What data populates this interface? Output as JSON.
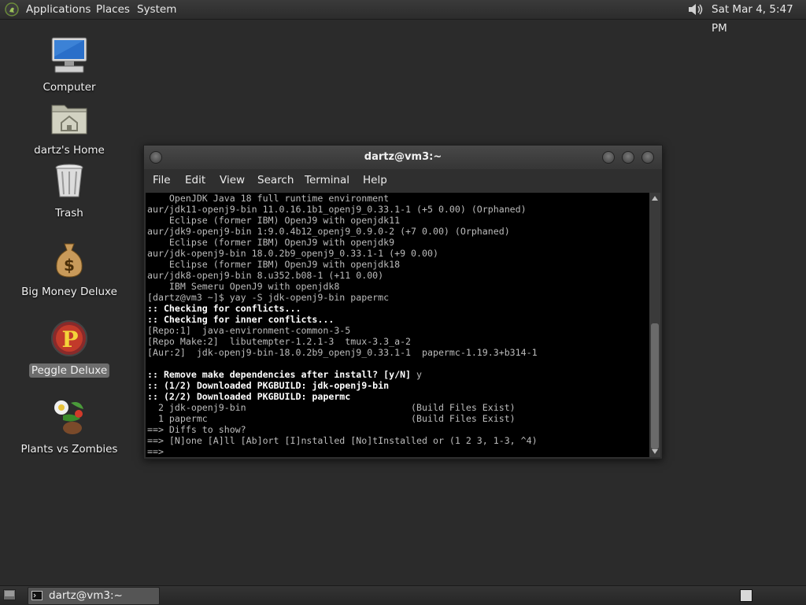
{
  "top_panel": {
    "menus": [
      "Applications",
      "Places",
      "System"
    ],
    "clock": "Sat Mar  4,  5:47 PM",
    "icons": {
      "foot": "gnome-foot-icon",
      "volume": "speaker-icon"
    }
  },
  "desktop_icons": [
    {
      "label": "Computer",
      "icon": "computer-icon"
    },
    {
      "label": "dartz's Home",
      "icon": "home-folder-icon"
    },
    {
      "label": "Trash",
      "icon": "trash-icon"
    },
    {
      "label": "Big Money Deluxe",
      "icon": "money-bag-icon"
    },
    {
      "label": "Peggle Deluxe",
      "icon": "peggle-icon",
      "selected": true
    },
    {
      "label": "Plants vs Zombies",
      "icon": "plants-vs-zombies-icon"
    }
  ],
  "terminal": {
    "title": "dartz@vm3:~",
    "menus": [
      "File",
      "Edit",
      "View",
      "Search",
      "Terminal",
      "Help"
    ],
    "lines": [
      {
        "text": "    OpenJDK Java 18 full runtime environment",
        "bold": false
      },
      {
        "text": "aur/jdk11-openj9-bin 11.0.16.1b1_openj9_0.33.1-1 (+5 0.00) (Orphaned)",
        "bold": false
      },
      {
        "text": "    Eclipse (former IBM) OpenJ9 with openjdk11",
        "bold": false
      },
      {
        "text": "aur/jdk9-openj9-bin 1:9.0.4b12_openj9_0.9.0-2 (+7 0.00) (Orphaned)",
        "bold": false
      },
      {
        "text": "    Eclipse (former IBM) OpenJ9 with openjdk9",
        "bold": false
      },
      {
        "text": "aur/jdk-openj9-bin 18.0.2b9_openj9_0.33.1-1 (+9 0.00)",
        "bold": false
      },
      {
        "text": "    Eclipse (former IBM) OpenJ9 with openjdk18",
        "bold": false
      },
      {
        "text": "aur/jdk8-openj9-bin 8.u352.b08-1 (+11 0.00)",
        "bold": false
      },
      {
        "text": "    IBM Semeru OpenJ9 with openjdk8",
        "bold": false
      },
      {
        "text": "[dartz@vm3 ~]$ yay -S jdk-openj9-bin papermc",
        "bold": false
      },
      {
        "text": ":: Checking for conflicts...",
        "bold": true
      },
      {
        "text": ":: Checking for inner conflicts...",
        "bold": true
      },
      {
        "text": "[Repo:1]  java-environment-common-3-5",
        "bold": false
      },
      {
        "text": "[Repo Make:2]  libutempter-1.2.1-3  tmux-3.3_a-2",
        "bold": false
      },
      {
        "text": "[Aur:2]  jdk-openj9-bin-18.0.2b9_openj9_0.33.1-1  papermc-1.19.3+b314-1",
        "bold": false
      },
      {
        "text": "",
        "bold": false
      },
      {
        "text": ":: Remove make dependencies after install? [y/N] ",
        "bold": true,
        "tail": "y"
      },
      {
        "text": ":: (1/2) Downloaded PKGBUILD: jdk-openj9-bin",
        "bold": true
      },
      {
        "text": ":: (2/2) Downloaded PKGBUILD: papermc",
        "bold": true
      },
      {
        "text": "  2 jdk-openj9-bin                              (Build Files Exist)",
        "bold": false
      },
      {
        "text": "  1 papermc                                     (Build Files Exist)",
        "bold": false
      },
      {
        "text": "==> Diffs to show?",
        "bold": false
      },
      {
        "text": "==> [N]one [A]ll [Ab]ort [I]nstalled [No]tInstalled or (1 2 3, 1-3, ^4)",
        "bold": false
      },
      {
        "text": "==> ",
        "bold": false
      }
    ]
  },
  "bottom_panel": {
    "task_label": "dartz@vm3:~",
    "icons": {
      "show_desktop": "show-desktop-icon",
      "task": "terminal-icon",
      "workspace": "workspace-switcher-icon"
    }
  }
}
